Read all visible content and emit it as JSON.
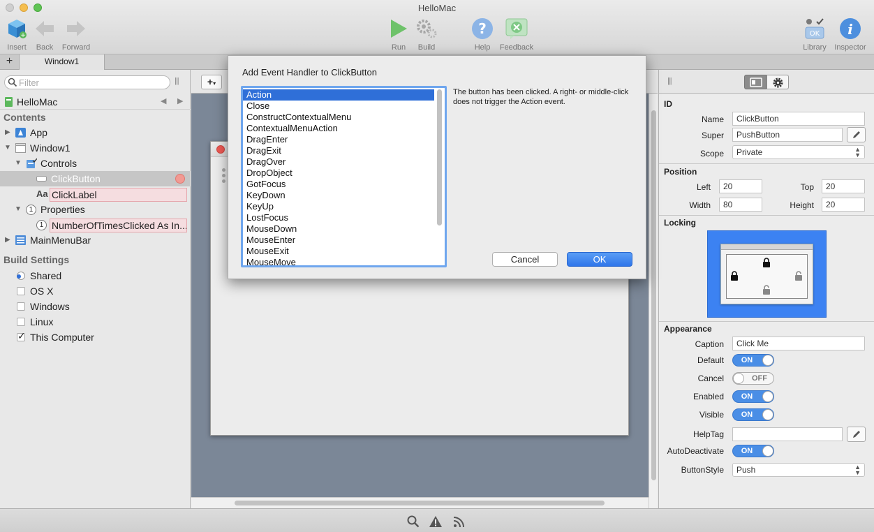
{
  "window": {
    "title": "HelloMac"
  },
  "toolbar": {
    "insert": "Insert",
    "back": "Back",
    "forward": "Forward",
    "run": "Run",
    "build": "Build",
    "help": "Help",
    "feedback": "Feedback",
    "library": "Library",
    "inspector": "Inspector",
    "library_ok_label": "OK"
  },
  "tabs": {
    "plus": "+",
    "active": "Window1"
  },
  "sidebar": {
    "filter_placeholder": "Filter",
    "project": "HelloMac",
    "contents_header": "Contents",
    "tree": {
      "app": "App",
      "window1": "Window1",
      "controls": "Controls",
      "click_button": "ClickButton",
      "click_label": "ClickLabel",
      "click_label_icon": "Aa",
      "properties": "Properties",
      "property_item": "NumberOfTimesClicked As In...",
      "property_badge": "1",
      "main_menu_bar": "MainMenuBar"
    },
    "build_settings_header": "Build Settings",
    "build_settings": {
      "shared": "Shared",
      "osx": "OS X",
      "windows": "Windows",
      "linux": "Linux",
      "this_computer": "This Computer"
    }
  },
  "dialog": {
    "title": "Add Event Handler to ClickButton",
    "events": [
      "Action",
      "Close",
      "ConstructContextualMenu",
      "ContextualMenuAction",
      "DragEnter",
      "DragExit",
      "DragOver",
      "DropObject",
      "GotFocus",
      "KeyDown",
      "KeyUp",
      "LostFocus",
      "MouseDown",
      "MouseEnter",
      "MouseExit",
      "MouseMove"
    ],
    "description": "The button has been clicked. A right- or middle-click does not trigger the Action event.",
    "cancel": "Cancel",
    "ok": "OK"
  },
  "inspector": {
    "id_header": "ID",
    "name_label": "Name",
    "name_value": "ClickButton",
    "super_label": "Super",
    "super_value": "PushButton",
    "scope_label": "Scope",
    "scope_value": "Private",
    "position_header": "Position",
    "left_label": "Left",
    "left_value": "20",
    "top_label": "Top",
    "top_value": "20",
    "width_label": "Width",
    "width_value": "80",
    "height_label": "Height",
    "height_value": "20",
    "locking_header": "Locking",
    "appearance_header": "Appearance",
    "caption_label": "Caption",
    "caption_value": "Click Me",
    "default_label": "Default",
    "default_state": "ON",
    "cancel_label": "Cancel",
    "cancel_state": "OFF",
    "enabled_label": "Enabled",
    "enabled_state": "ON",
    "visible_label": "Visible",
    "visible_state": "ON",
    "helptag_label": "HelpTag",
    "helptag_value": "",
    "autodeactivate_label": "AutoDeactivate",
    "autodeactivate_state": "ON",
    "buttonstyle_label": "ButtonStyle",
    "buttonstyle_value": "Push"
  },
  "colors": {
    "accent": "#2f6fd8",
    "toggle_on": "#4a8ee6",
    "locking_bg": "#3c82f2",
    "canvas": "#7b8797",
    "close_red": "#ef5a55"
  }
}
